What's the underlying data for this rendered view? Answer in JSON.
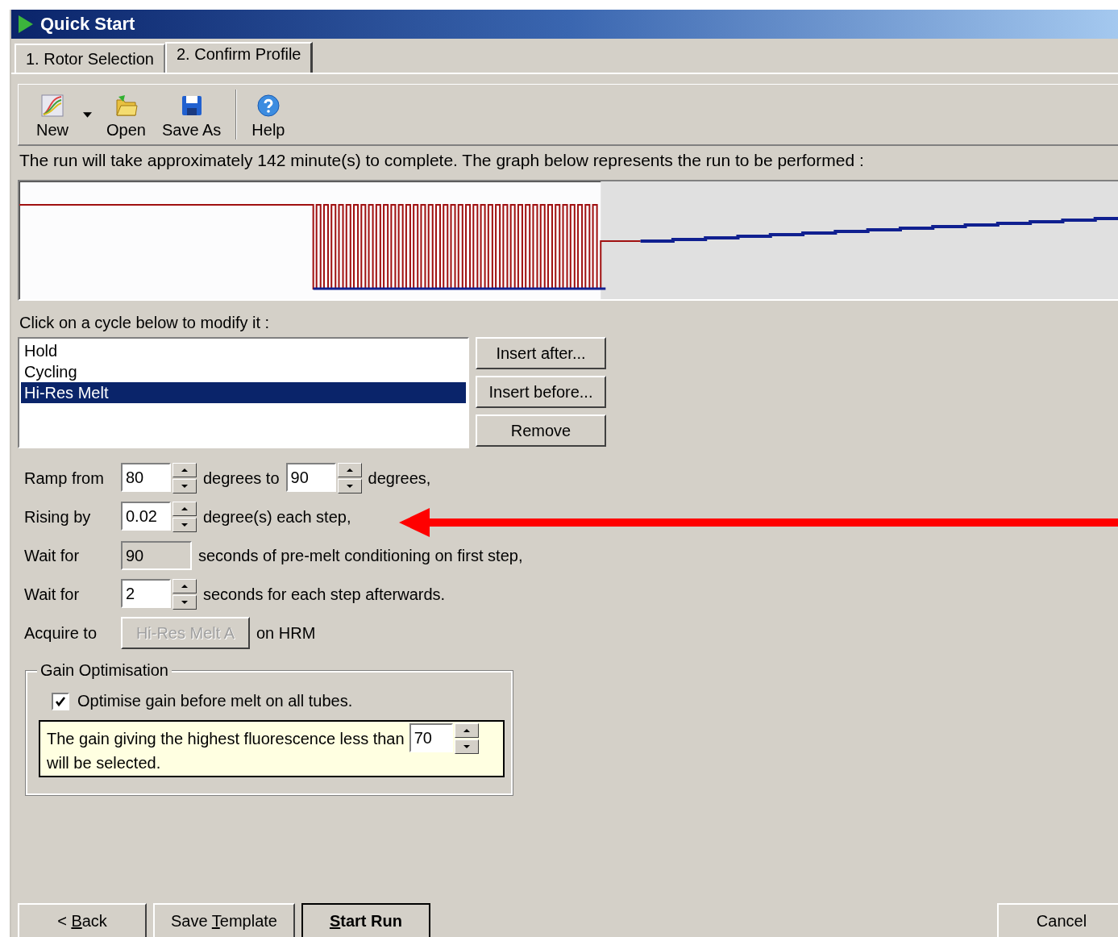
{
  "window": {
    "title": "Quick Start"
  },
  "tabs": [
    {
      "label": "1. Rotor Selection",
      "selected": false
    },
    {
      "label": "2. Confirm Profile",
      "selected": true
    }
  ],
  "toolbar": [
    {
      "kind": "new",
      "label": "New"
    },
    {
      "kind": "dropdown"
    },
    {
      "kind": "open",
      "label": "Open"
    },
    {
      "kind": "save",
      "label": "Save As"
    },
    {
      "kind": "separator"
    },
    {
      "kind": "help",
      "label": "Help"
    }
  ],
  "info_text": "The run will take approximately 142 minute(s) to complete. The graph below represents the run to be performed :",
  "cycle_prompt": "Click on a cycle below to modify it :",
  "cycles": [
    {
      "label": "Hold",
      "selected": false
    },
    {
      "label": "Cycling",
      "selected": false
    },
    {
      "label": "Hi-Res Melt",
      "selected": true
    }
  ],
  "cycle_buttons": [
    "Insert after...",
    "Insert before...",
    "Remove"
  ],
  "settings": [
    {
      "label": "Ramp from",
      "items": [
        {
          "kind": "spin",
          "value": "80"
        },
        {
          "kind": "text",
          "text": "degrees to"
        },
        {
          "kind": "spin",
          "value": "90"
        },
        {
          "kind": "text",
          "text": "degrees,"
        }
      ]
    },
    {
      "label": "Rising by",
      "items": [
        {
          "kind": "spin",
          "value": "0.02"
        },
        {
          "kind": "text",
          "text": "degree(s) each step,"
        }
      ]
    },
    {
      "label": "Wait for",
      "items": [
        {
          "kind": "field",
          "value": "90",
          "disabled": true
        },
        {
          "kind": "text",
          "text": "seconds of pre-melt conditioning on first step,"
        }
      ]
    },
    {
      "label": "Wait for",
      "items": [
        {
          "kind": "spin",
          "value": "2"
        },
        {
          "kind": "text",
          "text": "seconds for each step afterwards."
        }
      ]
    },
    {
      "label": "Acquire to",
      "items": [
        {
          "kind": "button",
          "label": "Hi-Res Melt A",
          "disabled": true
        },
        {
          "kind": "text",
          "text": "on HRM"
        }
      ]
    }
  ],
  "gain": {
    "title": "Gain Optimisation",
    "checkbox": {
      "label": "Optimise gain before melt on all tubes.",
      "checked": true
    },
    "note_before": "The gain giving the highest fluorescence less than",
    "value": "70",
    "note_after": "will be selected."
  },
  "footer": {
    "left": [
      {
        "before": "< ",
        "key": "B",
        "after": "ack",
        "default": false
      },
      {
        "before": "Save ",
        "key": "T",
        "after": "emplate",
        "default": false
      },
      {
        "key": "S",
        "after": "tart Run",
        "default": true
      }
    ],
    "right": [
      {
        "before": "Cancel",
        "default": false
      }
    ]
  }
}
